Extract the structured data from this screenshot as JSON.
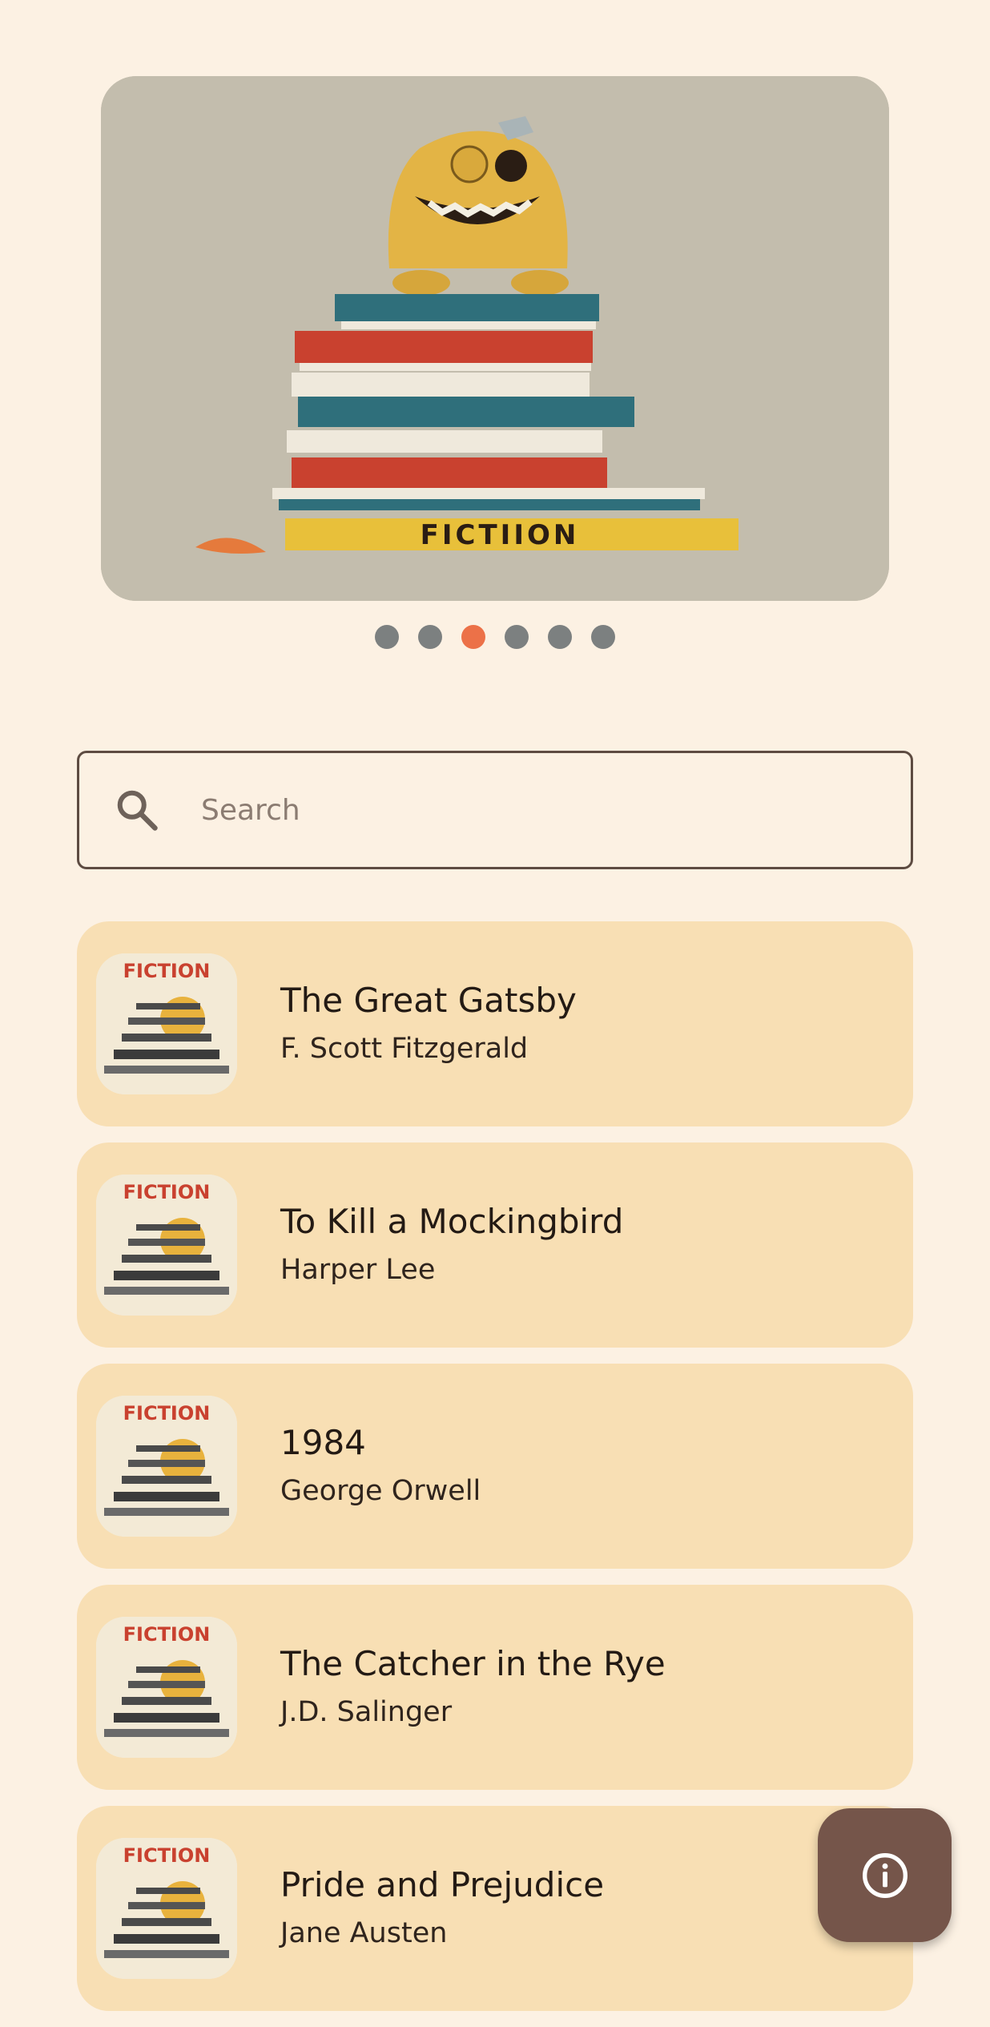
{
  "carousel": {
    "cover_text": "FICTIION",
    "slide_count": 6,
    "active_index": 2,
    "colors": {
      "dot": "#7c8080",
      "dot_active": "#ec7148"
    }
  },
  "search": {
    "placeholder": "Search",
    "value": "",
    "icon": "search-icon"
  },
  "books": [
    {
      "title": "The Great Gatsby",
      "author": "F. Scott Fitzgerald",
      "cover_text": "FICTION"
    },
    {
      "title": "To Kill a Mockingbird",
      "author": "Harper Lee",
      "cover_text": "FICTION"
    },
    {
      "title": "1984",
      "author": "George Orwell",
      "cover_text": "FICTION"
    },
    {
      "title": "The Catcher in the Rye",
      "author": "J.D. Salinger",
      "cover_text": "FICTION"
    },
    {
      "title": "Pride and Prejudice",
      "author": "Jane Austen",
      "cover_text": "FICTION"
    }
  ],
  "fab": {
    "icon": "info-icon"
  },
  "colors": {
    "background": "#fcf1e3",
    "card": "#f8dfb4",
    "fab": "#75554a",
    "search_border": "#5e4c42"
  }
}
